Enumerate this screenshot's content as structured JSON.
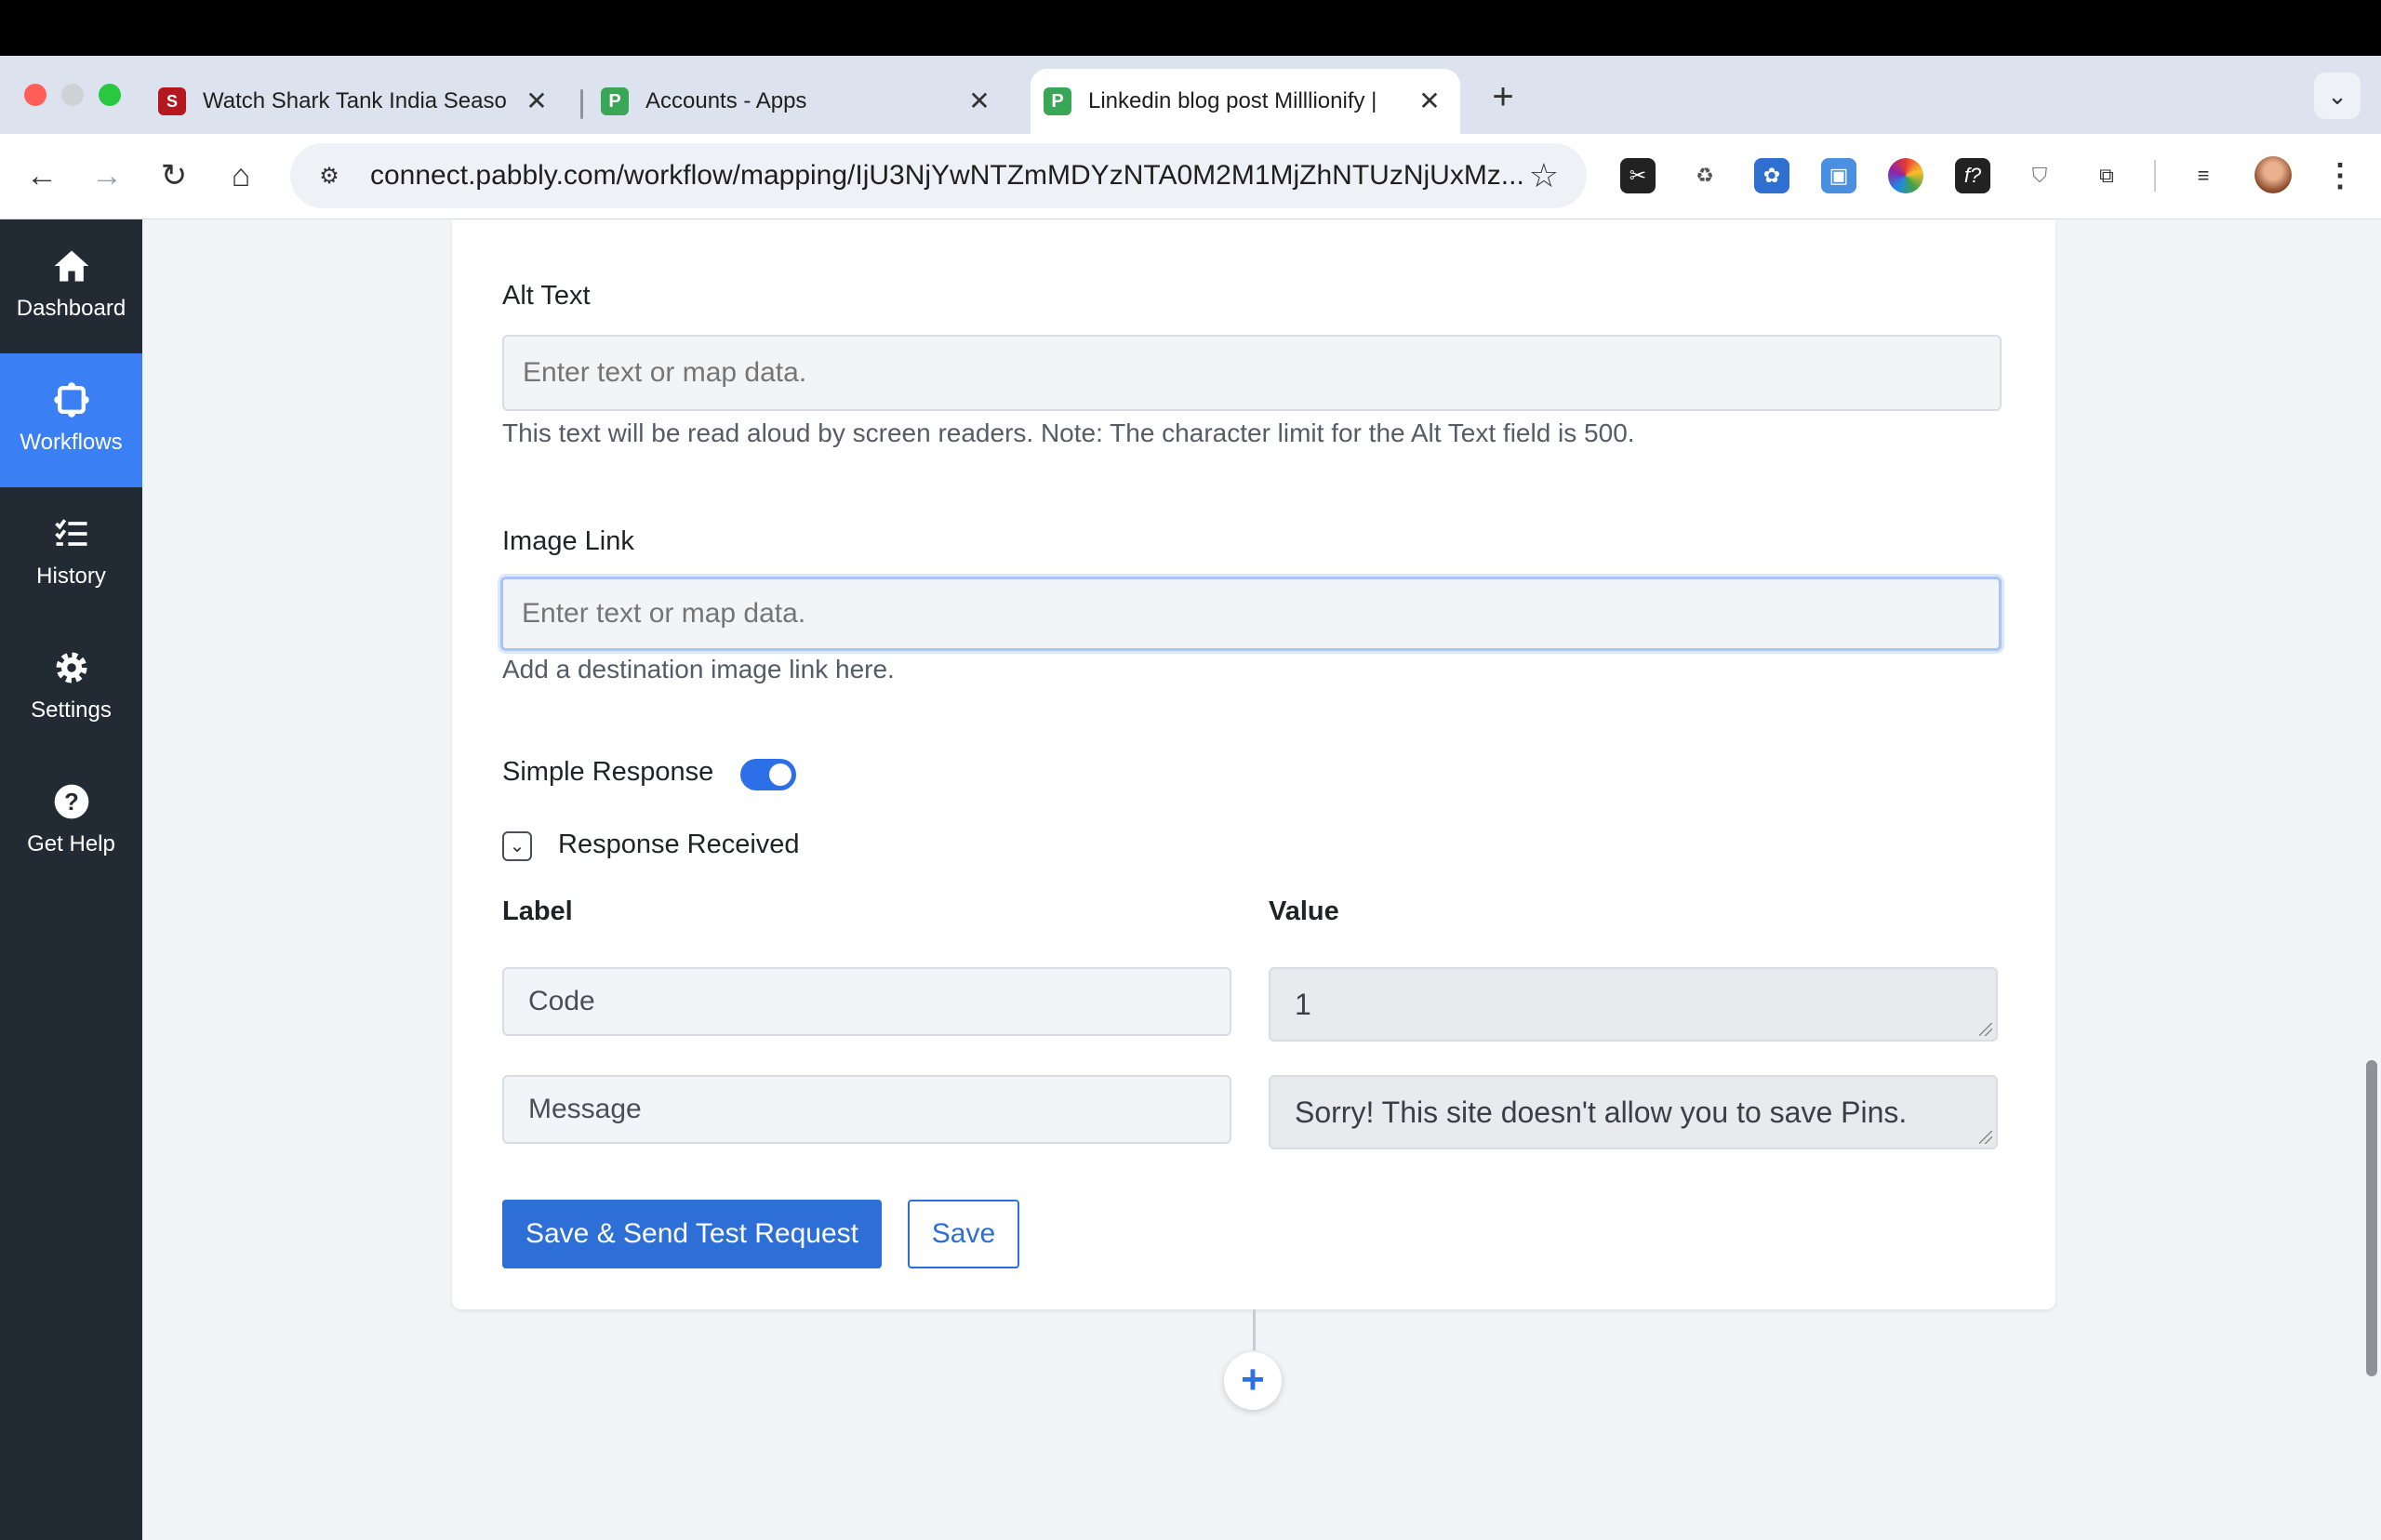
{
  "browser": {
    "tabs": [
      {
        "title": "Watch Shark Tank India Seaso",
        "favicon": "shark-tank-favicon"
      },
      {
        "title": "Accounts - Apps",
        "favicon": "pabbly-favicon"
      },
      {
        "title": "Linkedin blog post Milllionify |",
        "favicon": "pabbly-favicon",
        "active": true
      }
    ],
    "url": "connect.pabbly.com/workflow/mapping/IjU3NjYwNTZmMDYzNTA0M2M1MjZhNTUzNjUxMz...",
    "new_tab_symbol": "+",
    "close_symbol": "✕"
  },
  "sidebar": {
    "items": [
      {
        "label": "Dashboard",
        "icon": "home-icon"
      },
      {
        "label": "Workflows",
        "icon": "workflow-icon",
        "active": true
      },
      {
        "label": "History",
        "icon": "history-list-icon"
      },
      {
        "label": "Settings",
        "icon": "gear-icon"
      },
      {
        "label": "Get Help",
        "icon": "help-icon"
      }
    ]
  },
  "form": {
    "alt_text": {
      "label": "Alt Text",
      "placeholder": "Enter text or map data.",
      "help": "This text will be read aloud by screen readers. Note: The character limit for the Alt Text field is 500."
    },
    "image_link": {
      "label": "Image Link",
      "placeholder": "Enter text or map data.",
      "help": "Add a destination image link here."
    },
    "simple_response": {
      "label": "Simple Response",
      "enabled": true
    },
    "response_received": {
      "label": "Response Received"
    },
    "columns": {
      "label": "Label",
      "value": "Value"
    },
    "rows": [
      {
        "label": "Code",
        "value": "1"
      },
      {
        "label": "Message",
        "value": "Sorry! This site doesn't allow you to save Pins."
      }
    ],
    "buttons": {
      "save_test": "Save & Send Test Request",
      "save": "Save"
    }
  },
  "add_step_symbol": "+",
  "colors": {
    "accent": "#2d6fd6",
    "sidebar_bg": "#222b33",
    "sidebar_active": "#3a7ff3"
  }
}
